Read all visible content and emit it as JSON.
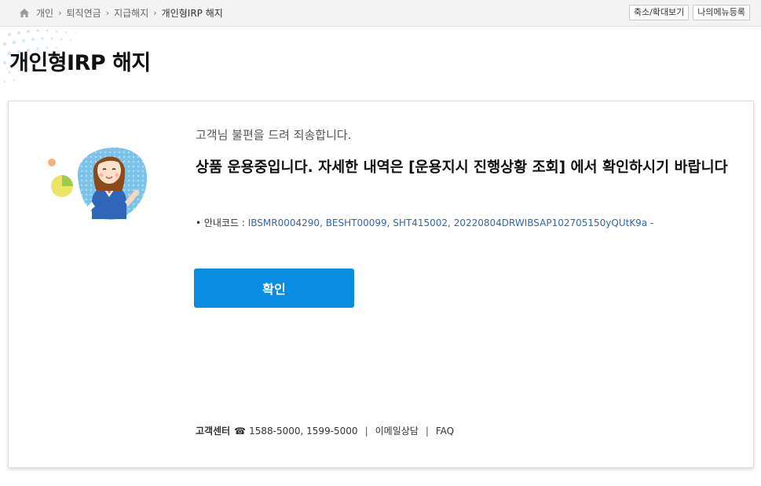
{
  "breadcrumb": {
    "items": [
      "개인",
      "퇴직연금",
      "지급해지",
      "개인형IRP 해지"
    ]
  },
  "top_buttons": {
    "zoom": "축소/확대보기",
    "register_menu": "나의메뉴등록"
  },
  "page": {
    "title": "개인형IRP 해지"
  },
  "message": {
    "apology": "고객님 불편을 드려 죄송합니다.",
    "main": "상품 운용중입니다. 자세한 내역은 [운용지시 진행상황 조회] 에서 확인하시기 바랍니다",
    "code_label": "• 안내코드 :",
    "codes": "IBSMR0004290, BESHT00099, SHT415002, 20220804DRWIBSAP102705150yQUtK9a -"
  },
  "actions": {
    "confirm": "확인"
  },
  "footer": {
    "center_label": "고객센터",
    "phone_icon": "☎",
    "phones": "1588-5000, 1599-5000",
    "email": "이메일상담",
    "faq": "FAQ",
    "sep": "|"
  },
  "colors": {
    "primary": "#0a8de0",
    "code_link": "#2a6ab0"
  }
}
